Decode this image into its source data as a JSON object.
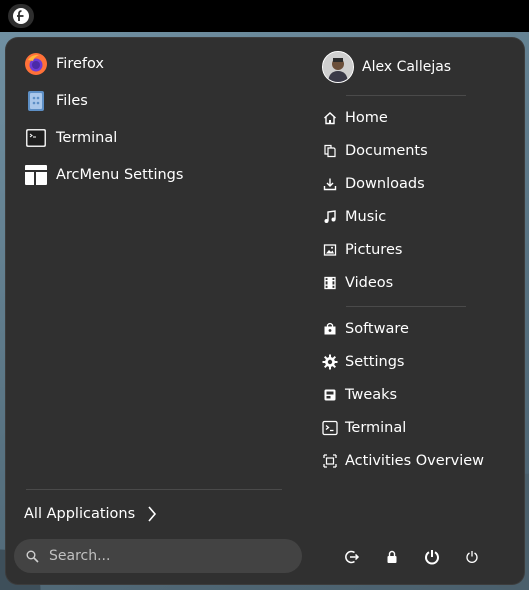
{
  "left_apps": [
    {
      "label": "Firefox",
      "icon": "firefox-icon"
    },
    {
      "label": "Files",
      "icon": "files-icon"
    },
    {
      "label": "Terminal",
      "icon": "terminal-icon"
    },
    {
      "label": "ArcMenu Settings",
      "icon": "arcmenu-settings-icon"
    }
  ],
  "all_applications_label": "All Applications",
  "search": {
    "placeholder": "Search..."
  },
  "user": {
    "name": "Alex Callejas"
  },
  "places": [
    {
      "label": "Home",
      "icon": "home-icon"
    },
    {
      "label": "Documents",
      "icon": "documents-icon"
    },
    {
      "label": "Downloads",
      "icon": "downloads-icon"
    },
    {
      "label": "Music",
      "icon": "music-icon"
    },
    {
      "label": "Pictures",
      "icon": "pictures-icon"
    },
    {
      "label": "Videos",
      "icon": "videos-icon"
    }
  ],
  "system_items": [
    {
      "label": "Software",
      "icon": "software-icon"
    },
    {
      "label": "Settings",
      "icon": "settings-gear-icon"
    },
    {
      "label": "Tweaks",
      "icon": "tweaks-icon"
    },
    {
      "label": "Terminal",
      "icon": "terminal-icon"
    },
    {
      "label": "Activities Overview",
      "icon": "activities-overview-icon"
    }
  ],
  "session_actions": [
    "logout-icon",
    "lock-icon",
    "suspend-icon",
    "power-off-icon"
  ],
  "colors": {
    "menu_bg": "#303030",
    "search_bg": "#434343",
    "divider": "#4a4a4a",
    "firefox_orange": "#ff7139"
  }
}
